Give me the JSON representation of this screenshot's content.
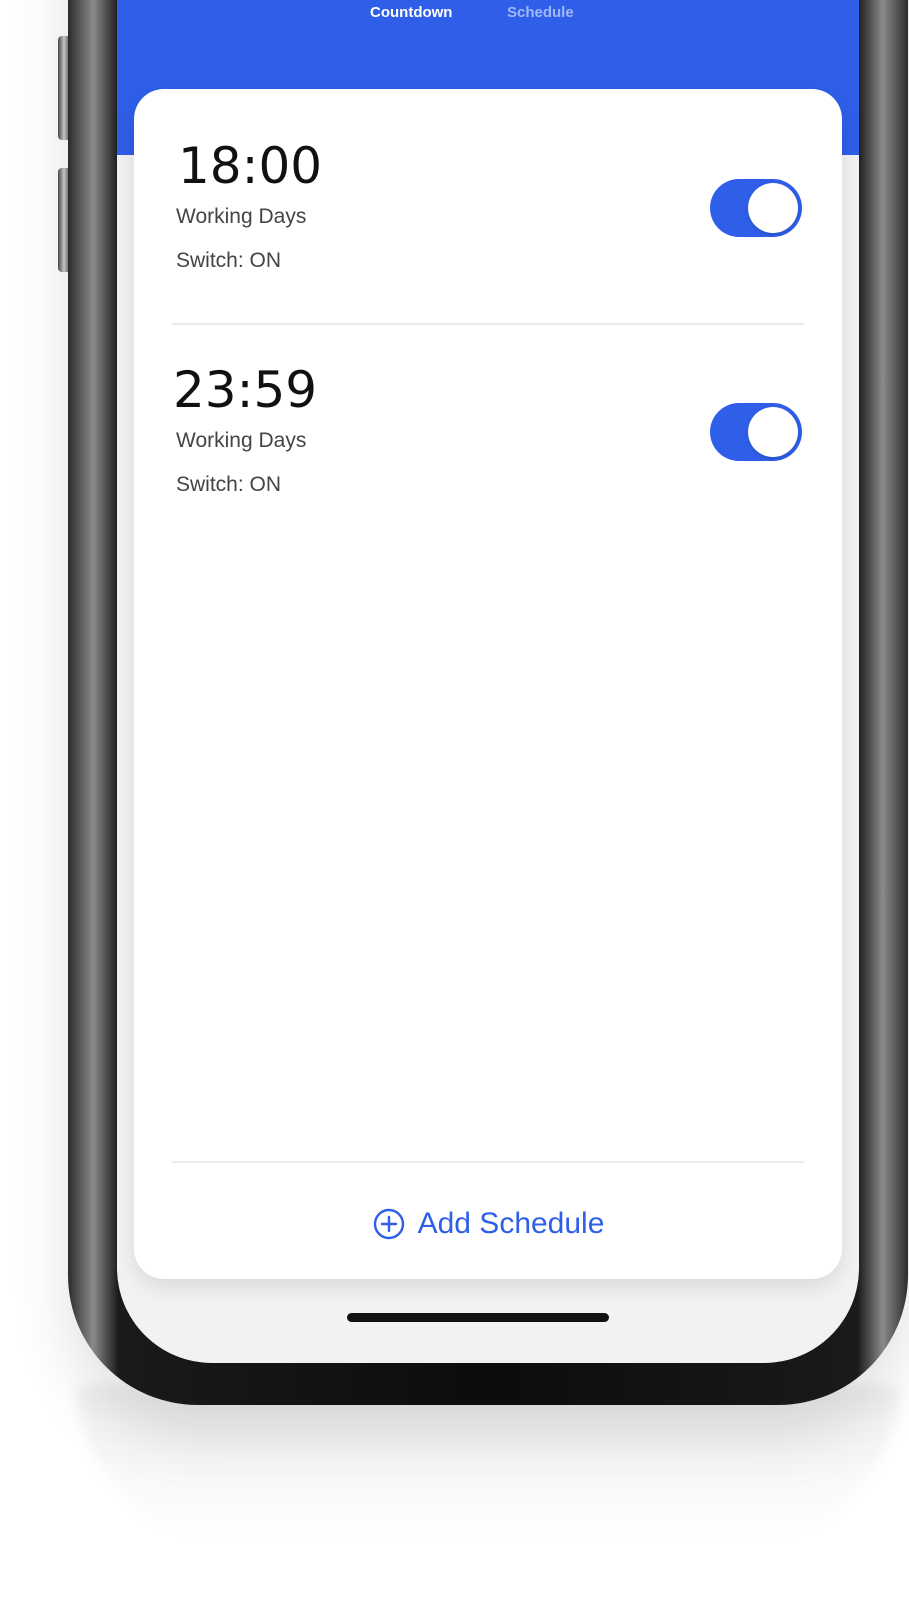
{
  "tabs": {
    "countdown": "Countdown",
    "schedule": "Schedule"
  },
  "schedules": [
    {
      "time": "18:00",
      "days": "Working Days",
      "status": "Switch: ON",
      "enabled": true
    },
    {
      "time": "23:59",
      "days": "Working Days",
      "status": "Switch: ON",
      "enabled": true
    }
  ],
  "add_button": {
    "label": "Add Schedule",
    "icon": "plus-circle-icon"
  },
  "colors": {
    "accent": "#2f5fe8",
    "background": "#f2f2f4",
    "card": "#ffffff"
  }
}
